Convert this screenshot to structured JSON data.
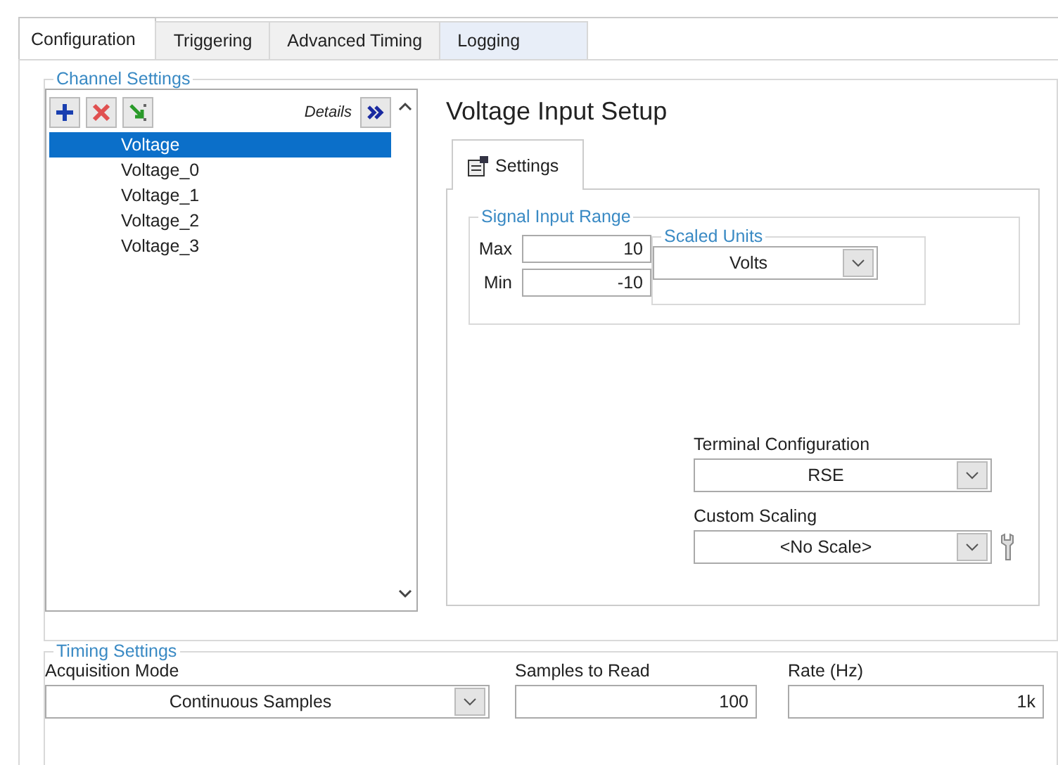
{
  "tabs": [
    {
      "label": "Configuration",
      "selected": true
    },
    {
      "label": "Triggering",
      "selected": false
    },
    {
      "label": "Advanced Timing",
      "selected": false
    },
    {
      "label": "Logging",
      "selected": false
    }
  ],
  "channel_settings": {
    "title": "Channel Settings",
    "details_label": "Details",
    "channels": [
      {
        "name": "Voltage",
        "selected": true
      },
      {
        "name": "Voltage_0",
        "selected": false
      },
      {
        "name": "Voltage_1",
        "selected": false
      },
      {
        "name": "Voltage_2",
        "selected": false
      },
      {
        "name": "Voltage_3",
        "selected": false
      }
    ]
  },
  "setup": {
    "title": "Voltage Input Setup",
    "tab": "Settings",
    "signal_input_range": {
      "title": "Signal Input Range",
      "max_label": "Max",
      "max": "10",
      "min_label": "Min",
      "min": "-10"
    },
    "scaled_units": {
      "title": "Scaled Units",
      "value": "Volts"
    },
    "terminal_configuration": {
      "label": "Terminal Configuration",
      "value": "RSE"
    },
    "custom_scaling": {
      "label": "Custom Scaling",
      "value": "<No Scale>"
    }
  },
  "timing_settings": {
    "title": "Timing Settings",
    "acquisition_mode": {
      "label": "Acquisition Mode",
      "value": "Continuous Samples"
    },
    "samples_to_read": {
      "label": "Samples to Read",
      "value": "100"
    },
    "rate": {
      "label": "Rate (Hz)",
      "value": "1k"
    }
  }
}
